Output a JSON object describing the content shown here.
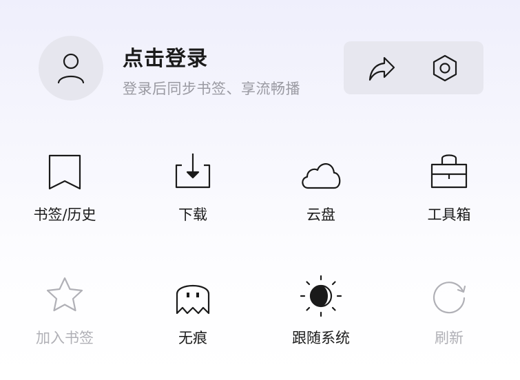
{
  "profile": {
    "title": "点击登录",
    "subtitle": "登录后同步书签、享流畅播",
    "avatar_icon": "user-icon",
    "share_icon": "share-icon",
    "settings_icon": "settings-icon"
  },
  "grid": {
    "row1": [
      {
        "label": "书签/历史",
        "icon": "bookmark-icon",
        "enabled": true
      },
      {
        "label": "下载",
        "icon": "download-icon",
        "enabled": true
      },
      {
        "label": "云盘",
        "icon": "cloud-icon",
        "enabled": true
      },
      {
        "label": "工具箱",
        "icon": "toolbox-icon",
        "enabled": true
      }
    ],
    "row2": [
      {
        "label": "加入书签",
        "icon": "star-icon",
        "enabled": false
      },
      {
        "label": "无痕",
        "icon": "ghost-icon",
        "enabled": true
      },
      {
        "label": "跟随系统",
        "icon": "theme-icon",
        "enabled": true
      },
      {
        "label": "刷新",
        "icon": "refresh-icon",
        "enabled": false
      }
    ]
  },
  "colors": {
    "text": "#1a1a1a",
    "subtext": "#9a9aa2",
    "disabled": "#b0b0b6",
    "pill_bg": "#e7e7ef",
    "avatar_bg": "#e6e6ee"
  }
}
